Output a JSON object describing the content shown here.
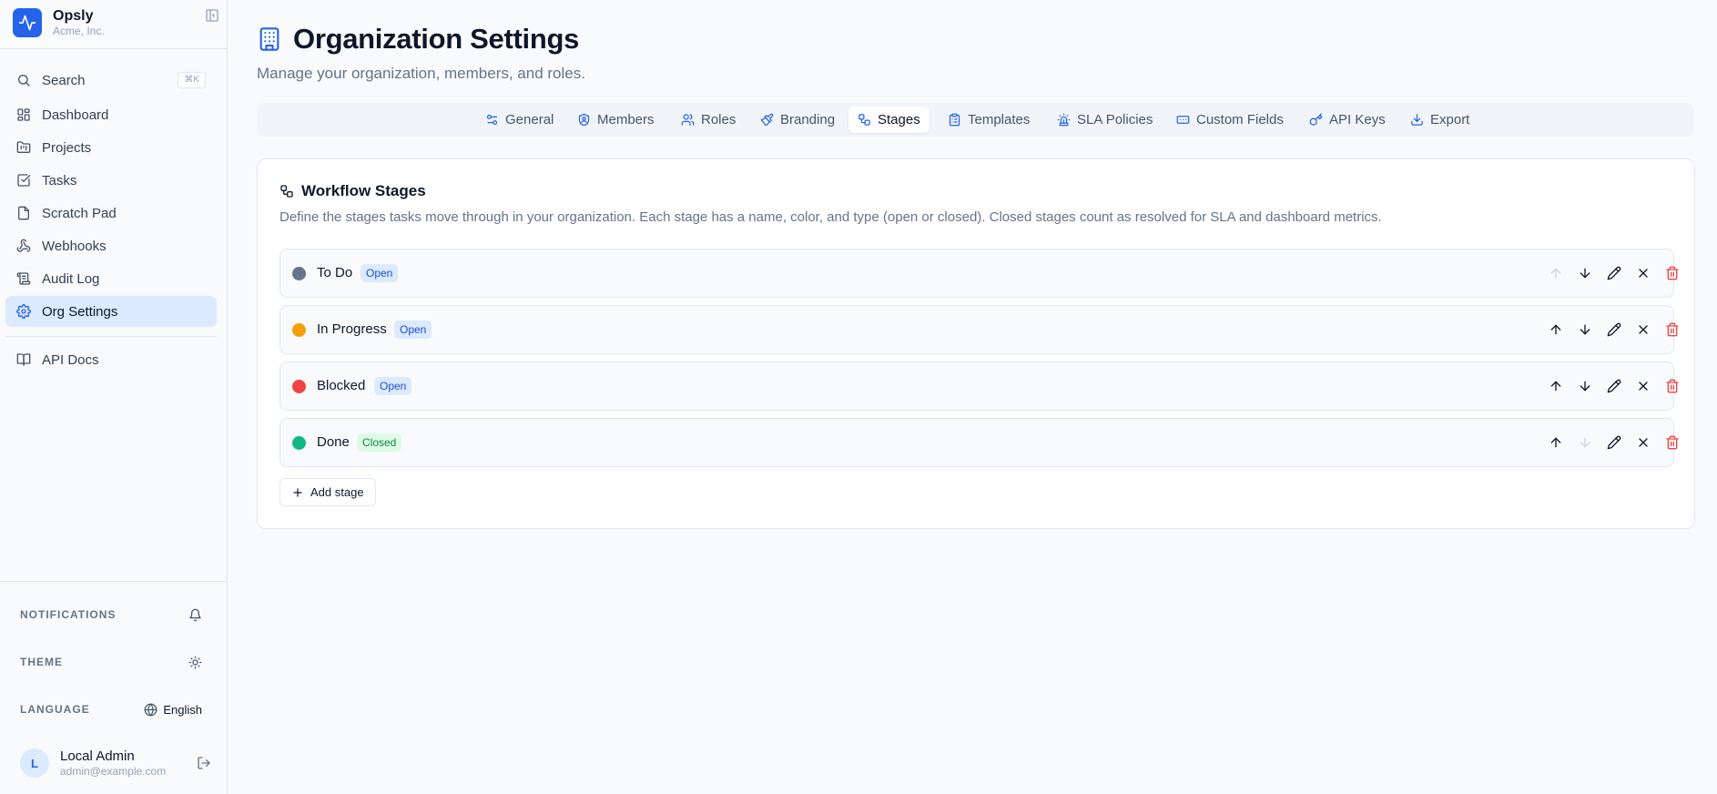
{
  "brand": {
    "name": "Opsly",
    "org": "Acme, Inc."
  },
  "sidebar": {
    "search": {
      "label": "Search",
      "shortcut": "⌘K"
    },
    "items": [
      {
        "label": "Dashboard",
        "icon": "layout-dashboard-icon"
      },
      {
        "label": "Projects",
        "icon": "folder-kanban-icon"
      },
      {
        "label": "Tasks",
        "icon": "square-check-icon"
      },
      {
        "label": "Scratch Pad",
        "icon": "file-icon"
      },
      {
        "label": "Webhooks",
        "icon": "webhook-icon"
      },
      {
        "label": "Audit Log",
        "icon": "scroll-text-icon"
      },
      {
        "label": "Org Settings",
        "icon": "gear-icon",
        "active": true
      }
    ],
    "api_docs": "API Docs",
    "notifications_label": "NOTIFICATIONS",
    "theme_label": "THEME",
    "language_label": "LANGUAGE",
    "language_value": "English",
    "user": {
      "initial": "L",
      "name": "Local Admin",
      "email": "admin@example.com"
    }
  },
  "page": {
    "title": "Organization Settings",
    "subtitle": "Manage your organization, members, and roles."
  },
  "tabs": [
    {
      "label": "General"
    },
    {
      "label": "Members"
    },
    {
      "label": "Roles"
    },
    {
      "label": "Branding"
    },
    {
      "label": "Stages",
      "active": true
    },
    {
      "label": "Templates"
    },
    {
      "label": "SLA Policies"
    },
    {
      "label": "Custom Fields"
    },
    {
      "label": "API Keys"
    },
    {
      "label": "Export"
    }
  ],
  "stages_card": {
    "title": "Workflow Stages",
    "description": "Define the stages tasks move through in your organization. Each stage has a name, color, and type (open or closed). Closed stages count as resolved for SLA and dashboard metrics.",
    "add_label": "Add stage",
    "stages": [
      {
        "name": "To Do",
        "type": "Open",
        "color": "#64748b"
      },
      {
        "name": "In Progress",
        "type": "Open",
        "color": "#f59e0b"
      },
      {
        "name": "Blocked",
        "type": "Open",
        "color": "#ef4444"
      },
      {
        "name": "Done",
        "type": "Closed",
        "color": "#10b981"
      }
    ]
  }
}
